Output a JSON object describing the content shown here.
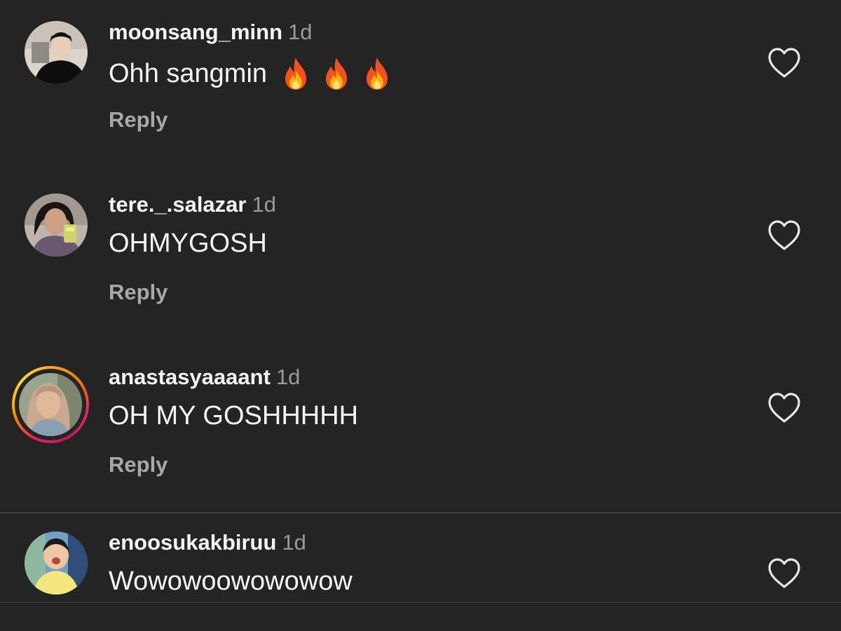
{
  "comments": [
    {
      "username": "moonsang_minn",
      "time": "1d",
      "text": "Ohh sangmin",
      "emoji": "fire-emoji",
      "reply_label": "Reply",
      "has_story": false
    },
    {
      "username": "tere._.salazar",
      "time": "1d",
      "text": "OHMYGOSH",
      "reply_label": "Reply",
      "has_story": false
    },
    {
      "username": "anastasyaaaant",
      "time": "1d",
      "text": "OH MY GOSHHHHH",
      "reply_label": "Reply",
      "has_story": true
    },
    {
      "username": "enoosukakbiruu",
      "time": "1d",
      "text": "Wowowoowowowow",
      "has_story": false
    }
  ],
  "icons": {
    "like": "heart-outline-icon"
  },
  "colors": {
    "background": "#242424",
    "text": "#f5f5f5",
    "muted": "#9a9a9a",
    "reply": "#a8a8a8"
  }
}
